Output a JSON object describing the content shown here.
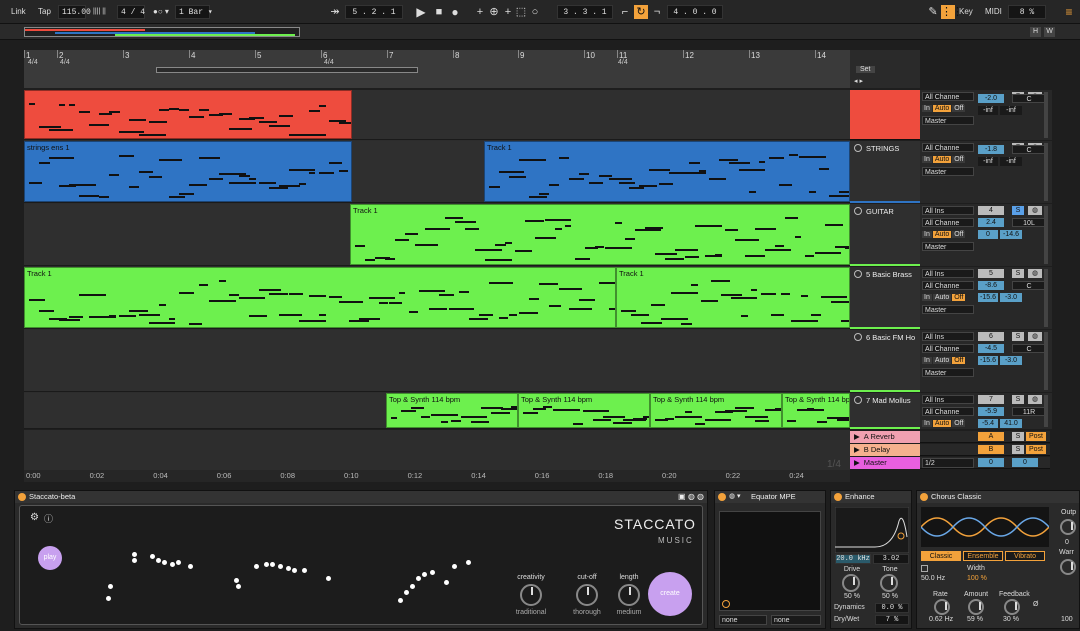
{
  "transport": {
    "link": "Link",
    "tap": "Tap",
    "tempo": "115.00",
    "signature": "4 / 4",
    "quantize": "1 Bar",
    "position": "5 .  2 .  1",
    "loop_start": "3 .  3 .  1",
    "loop_length": "4 .  0 .  0",
    "key": "Key",
    "midi": "MIDI",
    "cpu": "8 %"
  },
  "ruler": {
    "bars": [
      "1",
      "2",
      "3",
      "4",
      "5",
      "6",
      "7",
      "8",
      "9",
      "10",
      "11",
      "12",
      "13",
      "14"
    ],
    "signatures": [
      "4/4",
      "4/4",
      "4/4",
      "4/4"
    ],
    "set_label": "Set"
  },
  "tracks": [
    {
      "name": "",
      "color": "#ee4c3e",
      "input": "",
      "channel": "All Channe",
      "auto": "Auto",
      "off": "Off",
      "out": "Master",
      "num": "",
      "vol": "-2.0",
      "pan": "C",
      "peak1": "-inf",
      "peak2": "-inf",
      "clips": [
        {
          "name": ""
        }
      ]
    },
    {
      "name": "STRINGS",
      "color": "#2f74c4",
      "input": "",
      "channel": "All Channe",
      "auto": "Auto",
      "off": "Off",
      "out": "Master",
      "num": "",
      "vol": "-1.8",
      "pan": "C",
      "peak1": "-inf",
      "peak2": "-inf",
      "clips": [
        {
          "name": "strings ens 1"
        },
        {
          "name": "Track 1"
        }
      ]
    },
    {
      "name": "GUITAR",
      "color": "#6df04e",
      "input": "All Ins",
      "channel": "All Channe",
      "auto": "Auto",
      "off": "Off",
      "out": "Master",
      "num": "4",
      "vol": "2.4",
      "pan": "10L",
      "peak1": "0",
      "peak2": "-14.6",
      "clips": [
        {
          "name": "Track 1"
        }
      ]
    },
    {
      "name": "5 Basic Brass",
      "color": "#6df04e",
      "input": "All Ins",
      "channel": "All Channe",
      "auto": "Auto",
      "off": "Off",
      "out": "Master",
      "num": "5",
      "vol": "-8.6",
      "pan": "C",
      "peak1": "-15.6",
      "peak2": "-3.0",
      "clips": [
        {
          "name": "Track 1"
        },
        {
          "name": "Track 1"
        }
      ]
    },
    {
      "name": "6 Basic FM Ho",
      "color": "#6df04e",
      "input": "All Ins",
      "channel": "All Channe",
      "auto": "Auto",
      "off": "Off",
      "out": "Master",
      "num": "6",
      "vol": "-4.5",
      "pan": "C",
      "peak1": "-15.6",
      "peak2": "-3.0",
      "clips": []
    },
    {
      "name": "7 Mad Mollus",
      "color": "#6df04e",
      "input": "All Ins",
      "channel": "All Channe",
      "auto": "Auto",
      "off": "Off",
      "out": "",
      "num": "7",
      "vol": "-5.9",
      "pan": "11R",
      "peak1": "-5.4",
      "peak2": "41.0",
      "clips": [
        {
          "name": "Top & Synth 114 bpm"
        },
        {
          "name": "Top & Synth 114 bpm"
        },
        {
          "name": "Top & Synth 114 bpm"
        },
        {
          "name": "Top & Synth 114 bpm"
        }
      ]
    }
  ],
  "returns": [
    {
      "name": "A Reverb",
      "letter": "A",
      "solo": "S",
      "post": "Post",
      "color": "#f0a0b0"
    },
    {
      "name": "B Delay",
      "letter": "B",
      "solo": "S",
      "post": "Post",
      "color": "#f5b18e"
    },
    {
      "name": "Master",
      "letter": "0",
      "extra": "1/2",
      "value": "0",
      "color": "#e85fe0"
    }
  ],
  "page_indicator": "1/4",
  "time_marks": [
    "0:00",
    "0:02",
    "0:04",
    "0:06",
    "0:08",
    "0:10",
    "0:12",
    "0:14",
    "0:16",
    "0:18",
    "0:20",
    "0:22",
    "0:24"
  ],
  "devices": {
    "staccato": {
      "title": "Staccato-beta",
      "logo": "STACCATO",
      "logo_sub": "MUSIC",
      "play": "play",
      "create": "create",
      "knobs": [
        {
          "label": "creativity",
          "value": "traditional"
        },
        {
          "label": "cut-off",
          "value": "thorough"
        },
        {
          "label": "length",
          "value": "medium"
        }
      ]
    },
    "equator": {
      "title": "Equator MPE",
      "sel1": "none",
      "sel2": "none"
    },
    "enhance": {
      "title": "Enhance",
      "freq": "20.0 kHz",
      "q": "3.02",
      "drive_label": "Drive",
      "drive": "50 %",
      "tone_label": "Tone",
      "tone": "50 %",
      "dynamics_label": "Dynamics",
      "dynamics": "0.0 %",
      "drywet_label": "Dry/Wet",
      "drywet": "7 %"
    },
    "chorus": {
      "title": "Chorus Classic",
      "modes": [
        "Classic",
        "Ensemble",
        "Vibrato"
      ],
      "freq": "50.0 Hz",
      "width_label": "Width",
      "width": "100 %",
      "rate_label": "Rate",
      "rate": "0.62 Hz",
      "amount_label": "Amount",
      "amount": "59 %",
      "feedback_label": "Feedback",
      "feedback": "30 %",
      "phase": "Ø",
      "out_label": "Outp",
      "warm_label": "Warr",
      "out_val": "0",
      "warm_val": "100"
    }
  }
}
